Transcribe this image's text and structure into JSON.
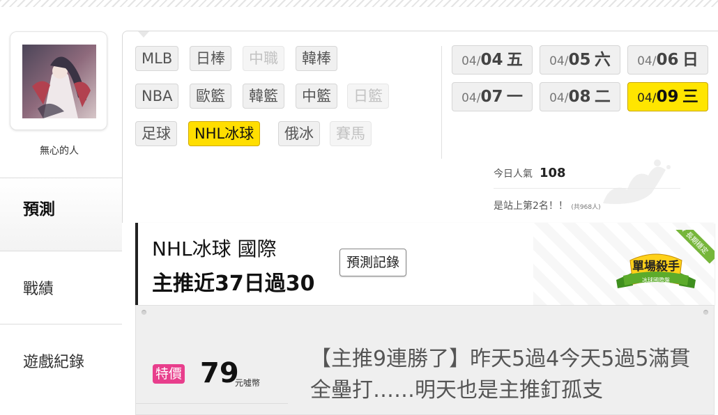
{
  "profile": {
    "username": "無心的人"
  },
  "sidebar": {
    "items": [
      {
        "label": "預測",
        "active": true
      },
      {
        "label": "戰績",
        "active": false
      },
      {
        "label": "遊戲紀錄",
        "active": false
      }
    ]
  },
  "filters": {
    "leagues": [
      {
        "label": "MLB",
        "state": "normal"
      },
      {
        "label": "日棒",
        "state": "normal"
      },
      {
        "label": "中職",
        "state": "disabled"
      },
      {
        "label": "韓棒",
        "state": "normal"
      },
      {
        "label": "NBA",
        "state": "normal"
      },
      {
        "label": "歐籃",
        "state": "normal"
      },
      {
        "label": "韓籃",
        "state": "normal"
      },
      {
        "label": "中籃",
        "state": "normal"
      },
      {
        "label": "日籃",
        "state": "disabled"
      },
      {
        "label": "足球",
        "state": "normal"
      },
      {
        "label": "NHL冰球",
        "state": "selected"
      },
      {
        "label": "俄冰",
        "state": "normal"
      },
      {
        "label": "賽馬",
        "state": "disabled"
      }
    ]
  },
  "dates": [
    {
      "month": "04/",
      "day": "04",
      "weekday": "五",
      "active": false
    },
    {
      "month": "04/",
      "day": "05",
      "weekday": "六",
      "active": false
    },
    {
      "month": "04/",
      "day": "06",
      "weekday": "日",
      "active": false
    },
    {
      "month": "04/",
      "day": "07",
      "weekday": "一",
      "active": false
    },
    {
      "month": "04/",
      "day": "08",
      "weekday": "二",
      "active": false
    },
    {
      "month": "04/",
      "day": "09",
      "weekday": "三",
      "active": true
    }
  ],
  "popularity": {
    "label": "今日人氣",
    "value": "108",
    "rank_text": "是站上第2名！！",
    "rank_note": "(共968人)"
  },
  "header": {
    "title": "NHL冰球 國際",
    "subtitle": "主推近37日過30",
    "record_button": "預測記錄",
    "badge_title": "單場殺手",
    "badge_sub": "冰球國際盤",
    "ribbon": "★ 長期穩定"
  },
  "product": {
    "tag": "特價",
    "price": "79",
    "unit": "元噓幣",
    "description": "【主推9連勝了】昨天5過4今天5過5滿貫全壘打……明天也是主推釘孤支"
  },
  "colors": {
    "accent_yellow": "#ffde00",
    "tag_pink": "#e83e8c"
  }
}
